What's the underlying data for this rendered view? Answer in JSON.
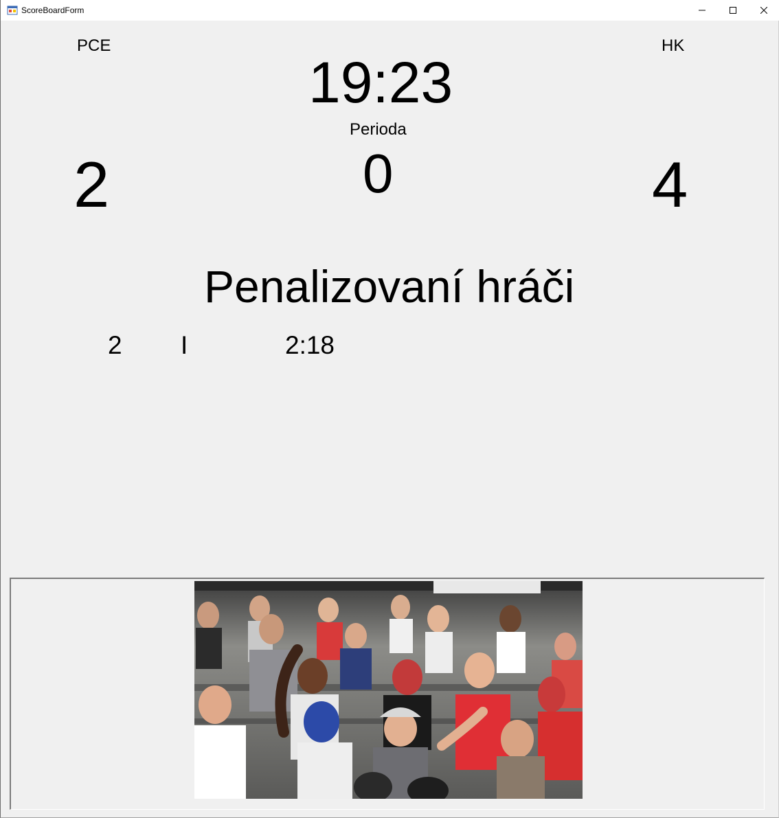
{
  "window": {
    "title": "ScoreBoardForm"
  },
  "scoreboard": {
    "home_team": "PCE",
    "away_team": "HK",
    "clock": "19:23",
    "period_label": "Perioda",
    "period_value": "0",
    "home_score": "2",
    "away_score": "4"
  },
  "penalties": {
    "title": "Penalizovaní hráči",
    "rows": [
      {
        "number": "2",
        "type": "I",
        "time": "2:18"
      }
    ]
  },
  "icons": {
    "app": "app-form-icon",
    "minimize": "minimize-icon",
    "maximize": "maximize-icon",
    "close": "close-icon"
  },
  "colors": {
    "background": "#f0f0f0",
    "titlebar": "#ffffff",
    "text": "#000000"
  }
}
